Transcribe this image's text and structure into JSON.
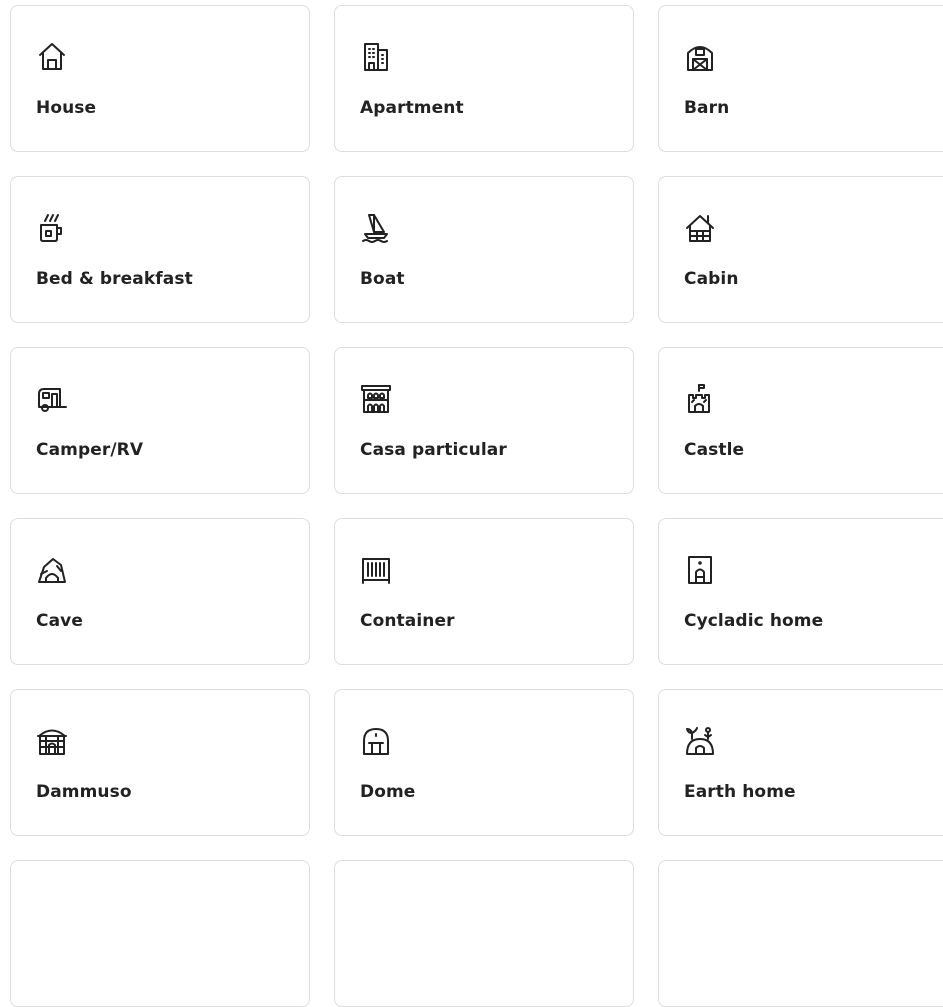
{
  "property_types": [
    {
      "label": "House",
      "icon": "house-icon"
    },
    {
      "label": "Apartment",
      "icon": "apartment-icon"
    },
    {
      "label": "Barn",
      "icon": "barn-icon"
    },
    {
      "label": "Bed & breakfast",
      "icon": "bed-breakfast-icon"
    },
    {
      "label": "Boat",
      "icon": "boat-icon"
    },
    {
      "label": "Cabin",
      "icon": "cabin-icon"
    },
    {
      "label": "Camper/RV",
      "icon": "camper-icon"
    },
    {
      "label": "Casa particular",
      "icon": "casa-particular-icon"
    },
    {
      "label": "Castle",
      "icon": "castle-icon"
    },
    {
      "label": "Cave",
      "icon": "cave-icon"
    },
    {
      "label": "Container",
      "icon": "container-icon"
    },
    {
      "label": "Cycladic home",
      "icon": "cycladic-home-icon"
    },
    {
      "label": "Dammuso",
      "icon": "dammuso-icon"
    },
    {
      "label": "Dome",
      "icon": "dome-icon"
    },
    {
      "label": "Earth home",
      "icon": "earth-home-icon"
    }
  ],
  "colors": {
    "text": "#222222",
    "border": "#dddddd",
    "background": "#ffffff"
  }
}
